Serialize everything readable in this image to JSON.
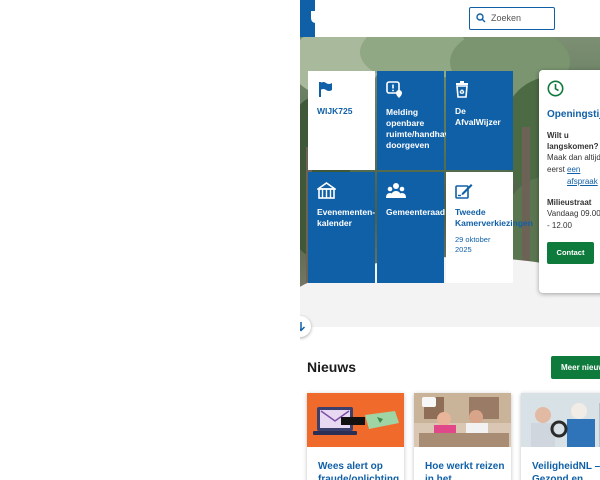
{
  "search": {
    "placeholder": "Zoeken",
    "icon": "search-icon"
  },
  "tiles": [
    {
      "label": "WIJK725",
      "icon": "flag-icon"
    },
    {
      "label": "Melding openbare ruimte/handhaving doorgeven",
      "icon": "report-location-icon"
    },
    {
      "label": "De AfvalWijzer",
      "icon": "waste-bin-icon"
    },
    {
      "label": "Evenementen-kalender",
      "icon": "tent-icon"
    },
    {
      "label": "Gemeenteraad",
      "icon": "people-icon"
    },
    {
      "label": "Tweede Kamerverkiezingen",
      "date": "29 oktober 2025",
      "icon": "ballot-icon"
    }
  ],
  "opening_card": {
    "title": "Openingstijden",
    "visit_heading": "Wilt u langskomen?",
    "visit_text_1": "Maak dan altijd",
    "visit_text_2": "eerst",
    "visit_link": "een afspraak",
    "milieustraat_heading": "Milieustraat",
    "milieustraat_hours_1": "Vandaag 09.00",
    "milieustraat_hours_2": "- 12.00",
    "contact_label": "Contact"
  },
  "news": {
    "title": "Nieuws",
    "more_label": "Meer nieuws",
    "cards": [
      {
        "title": "Wees alert op fraude/oplichting"
      },
      {
        "title": "Hoe werkt reizen in het"
      },
      {
        "title": "VeiligheidNL – Gezond en"
      }
    ]
  },
  "colors": {
    "brand_blue": "#1060a8",
    "brand_green": "#0e7a3c"
  }
}
